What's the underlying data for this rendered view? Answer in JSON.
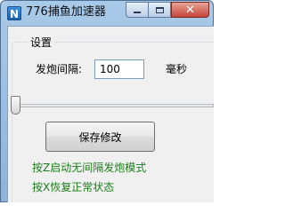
{
  "window": {
    "title": "776捕鱼加速器",
    "app_icon_letter": "N",
    "controls": {
      "minimize_icon": "minimize-icon",
      "maximize_icon": "maximize-icon",
      "close_icon": "close-icon",
      "close_glyph": "✕"
    }
  },
  "settings": {
    "group_label": "设置",
    "fire_interval_label": "发炮间隔:",
    "fire_interval_value": "100",
    "fire_interval_unit": "毫秒",
    "slider_position": 0,
    "save_button_label": "保存修改",
    "hints": [
      "按Z启动无间隔发炮模式",
      "按X恢复正常状态"
    ]
  },
  "colors": {
    "hint_text": "#1a7f1a",
    "close_button": "#c6453a",
    "title_bar": "#a9c9e8"
  }
}
